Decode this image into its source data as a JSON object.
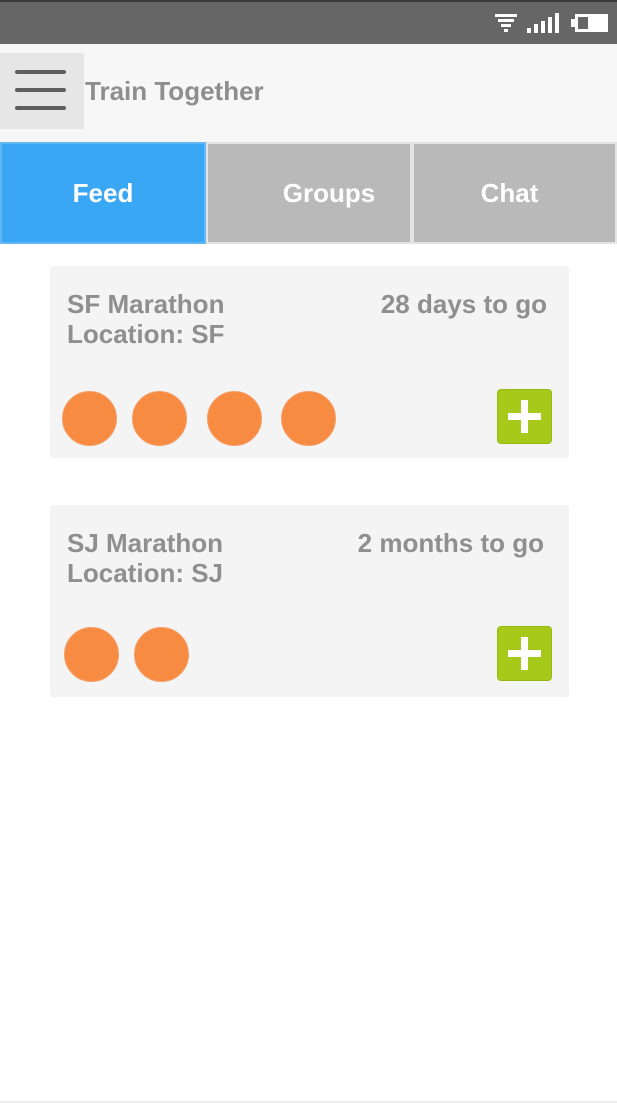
{
  "app": {
    "title": "Train Together"
  },
  "status_bar": {
    "icons": [
      "wifi-icon",
      "signal-icon",
      "battery-icon"
    ]
  },
  "tabs": [
    {
      "label": "Feed",
      "active": true
    },
    {
      "label": "Groups",
      "active": false
    },
    {
      "label": "Chat",
      "active": false
    }
  ],
  "feed": [
    {
      "title": "SF Marathon",
      "location": "Location: SF",
      "countdown": "28 days to go",
      "participants": 4
    },
    {
      "title": "SJ Marathon",
      "location": "Location: SJ",
      "countdown": "2 months to go",
      "participants": 2
    }
  ],
  "colors": {
    "active_tab": "#3aa7f5",
    "inactive_tab": "#b9b9b9",
    "avatar": "#f88b42",
    "add_button": "#a7ca1a",
    "status_bar": "#666666"
  }
}
